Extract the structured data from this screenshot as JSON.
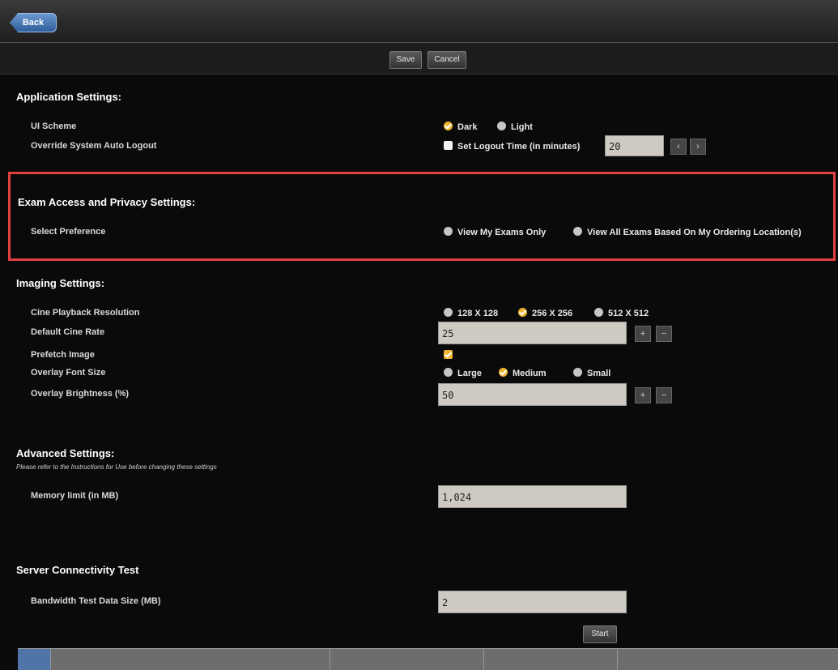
{
  "topbar": {
    "back_label": "Back"
  },
  "actions": {
    "save_label": "Save",
    "cancel_label": "Cancel"
  },
  "application": {
    "title": "Application Settings:",
    "ui_scheme_label": "UI Scheme",
    "ui_scheme_options": [
      "Dark",
      "Light"
    ],
    "ui_scheme_selected": "Dark",
    "auto_logout_label": "Override System Auto Logout",
    "logout_checkbox_label": "Set Logout Time (in minutes)",
    "logout_value": "20"
  },
  "privacy": {
    "title": "Exam Access and Privacy Settings:",
    "preference_label": "Select Preference",
    "options": [
      "View My Exams Only",
      "View All Exams Based On My Ordering Location(s)"
    ]
  },
  "imaging": {
    "title": "Imaging Settings:",
    "cine_resolution_label": "Cine Playback Resolution",
    "cine_resolution_options": [
      "128 X 128",
      "256 X 256",
      "512 X 512"
    ],
    "cine_resolution_selected": "256 X 256",
    "cine_rate_label": "Default Cine Rate",
    "cine_rate_value": "25",
    "prefetch_label": "Prefetch Image",
    "prefetch_checked": true,
    "font_size_label": "Overlay Font Size",
    "font_size_options": [
      "Large",
      "Medium",
      "Small"
    ],
    "font_size_selected": "Medium",
    "brightness_label": "Overlay Brightness (%)",
    "brightness_value": "50"
  },
  "advanced": {
    "title": "Advanced Settings:",
    "note": "Please refer to the Instructions for Use before changing these settings",
    "memory_label": "Memory limit (in MB)",
    "memory_value": "1,024"
  },
  "server": {
    "title": "Server Connectivity Test",
    "bandwidth_label": "Bandwidth Test Data Size (MB)",
    "bandwidth_value": "2",
    "start_label": "Start"
  },
  "colors": {
    "accent": "#f0b531",
    "highlight_border": "#e1403e",
    "field_bg": "#cfcac1"
  }
}
